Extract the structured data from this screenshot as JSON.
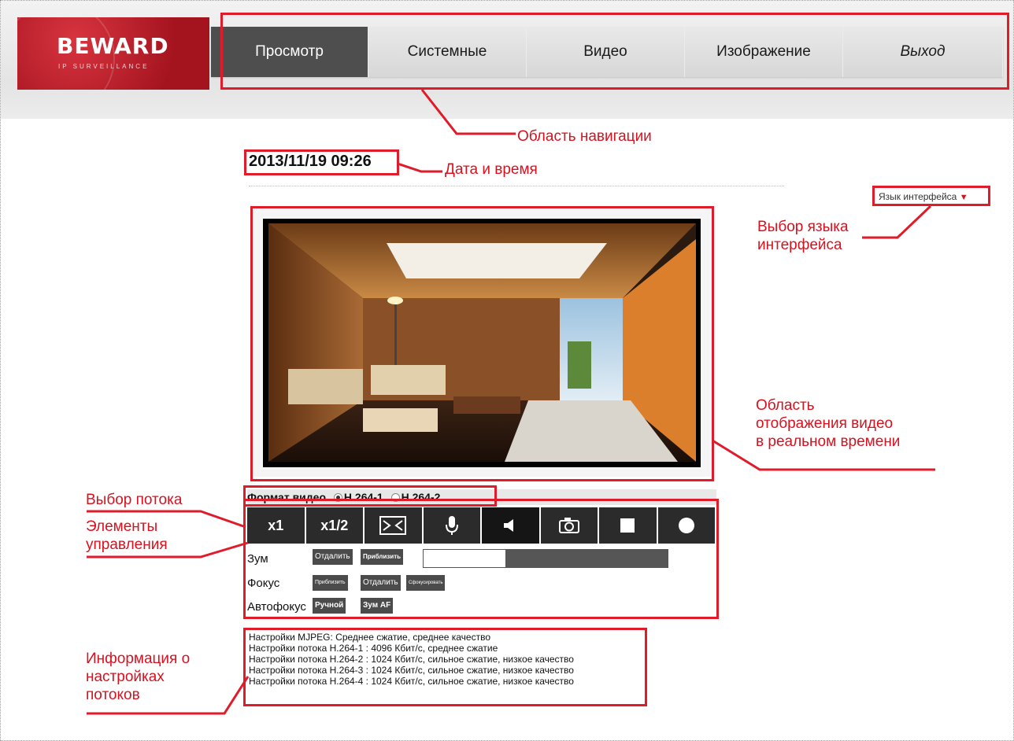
{
  "logo": {
    "brand": "BEWARD",
    "tagline": "IP SURVEILLANCE"
  },
  "nav": [
    {
      "label": "Просмотр",
      "active": true
    },
    {
      "label": "Системные"
    },
    {
      "label": "Видео"
    },
    {
      "label": "Изображение"
    },
    {
      "label": "Выход"
    }
  ],
  "datetime": "2013/11/19 09:26",
  "language": {
    "label": "Язык интерфейса",
    "icon": "triangle-down-icon"
  },
  "stream": {
    "label": "Формат видео",
    "options": [
      "H.264-1",
      "H.264-2"
    ],
    "selected": "H.264-1"
  },
  "controls": [
    {
      "label": "x1",
      "icon": "zoom-x1"
    },
    {
      "label": "x1/2",
      "icon": "zoom-half"
    },
    {
      "label": "",
      "icon": "fullscreen-icon"
    },
    {
      "label": "",
      "icon": "microphone-icon"
    },
    {
      "label": "",
      "icon": "speaker-icon"
    },
    {
      "label": "",
      "icon": "camera-icon"
    },
    {
      "label": "",
      "icon": "stop-icon"
    },
    {
      "label": "",
      "icon": "record-icon"
    }
  ],
  "zoom": {
    "label": "Зум",
    "out": "Отдалить",
    "in": "Приблизить",
    "level": 0.34
  },
  "focus": {
    "label": "Фокус",
    "near": "Приблизить",
    "far": "Отдалить",
    "auto": "Сфокусировать"
  },
  "autofocus": {
    "label": "Автофокус",
    "manual": "Ручной",
    "zoom_af": "Зум AF"
  },
  "stream_info": [
    "Настройки MJPEG: Среднее сжатие, среднее качество",
    "Настройки потока H.264-1 : 4096 Кбит/с, среднее сжатие",
    "Настройки потока H.264-2 : 1024 Кбит/с, сильное сжатие, низкое качество",
    "Настройки потока H.264-3 : 1024 Кбит/с, сильное сжатие, низкое качество",
    "Настройки потока H.264-4 : 1024 Кбит/с, сильное сжатие, низкое качество"
  ],
  "annotations": {
    "nav_area": "Область навигации",
    "date_time": "Дата и время",
    "language_select": [
      "Выбор языка",
      "интерфейса"
    ],
    "video_area": [
      "Область",
      "отображения видео",
      "в реальном времени"
    ],
    "stream_select": "Выбор потока",
    "controls": [
      "Элементы",
      "управления"
    ],
    "stream_info": [
      "Информация о",
      "настройках",
      "потоков"
    ]
  },
  "colors": {
    "annotation": "#e01b2a",
    "nav_active": "#4e4e4e",
    "brand": "#b51a25"
  }
}
